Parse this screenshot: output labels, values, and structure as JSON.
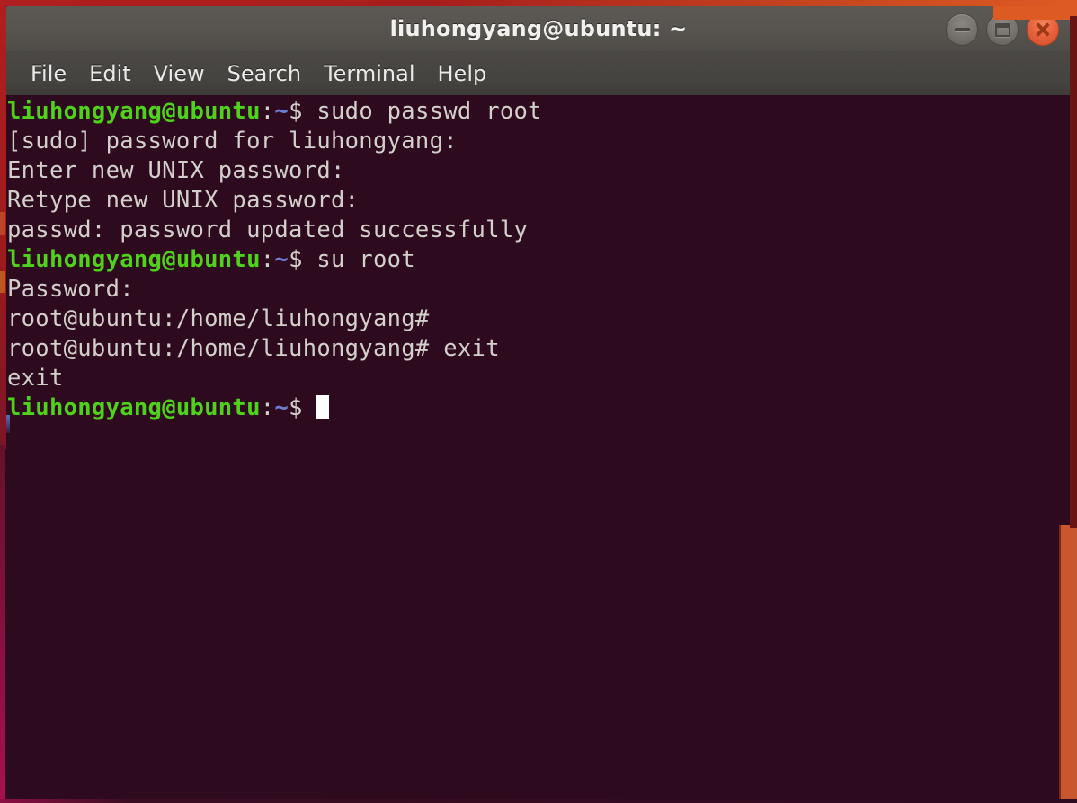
{
  "window": {
    "title": "liuhongyang@ubuntu: ~",
    "controls": {
      "minimize_label": "minimize",
      "maximize_label": "maximize",
      "close_label": "close"
    }
  },
  "menubar": {
    "items": [
      {
        "label": "File"
      },
      {
        "label": "Edit"
      },
      {
        "label": "View"
      },
      {
        "label": "Search"
      },
      {
        "label": "Terminal"
      },
      {
        "label": "Help"
      }
    ]
  },
  "terminal": {
    "prompt_user_host": "liuhongyang@ubuntu",
    "prompt_colon": ":",
    "prompt_path": "~",
    "prompt_sigil": "$ ",
    "root_prompt": "root@ubuntu:/home/liuhongyang# ",
    "lines": [
      {
        "type": "prompt",
        "command": "sudo passwd root"
      },
      {
        "type": "output",
        "text": "[sudo] password for liuhongyang:"
      },
      {
        "type": "output",
        "text": "Enter new UNIX password:"
      },
      {
        "type": "output",
        "text": "Retype new UNIX password:"
      },
      {
        "type": "output",
        "text": "passwd: password updated successfully"
      },
      {
        "type": "prompt",
        "command": "su root"
      },
      {
        "type": "output",
        "text": "Password:"
      },
      {
        "type": "root",
        "command": ""
      },
      {
        "type": "root",
        "command": "exit"
      },
      {
        "type": "output",
        "text": "exit"
      },
      {
        "type": "prompt",
        "command": "",
        "cursor": true
      }
    ]
  },
  "colors": {
    "terminal_background": "#2d0a1e",
    "prompt_green": "#4fd21a",
    "prompt_blue": "#6a7fd4",
    "output_white": "#d3cfcb",
    "titlebar_gray": "#57544f",
    "close_button_orange": "#e8603a",
    "scrollbar_orange": "#c8572f",
    "frame_red": "#b01f1f"
  }
}
